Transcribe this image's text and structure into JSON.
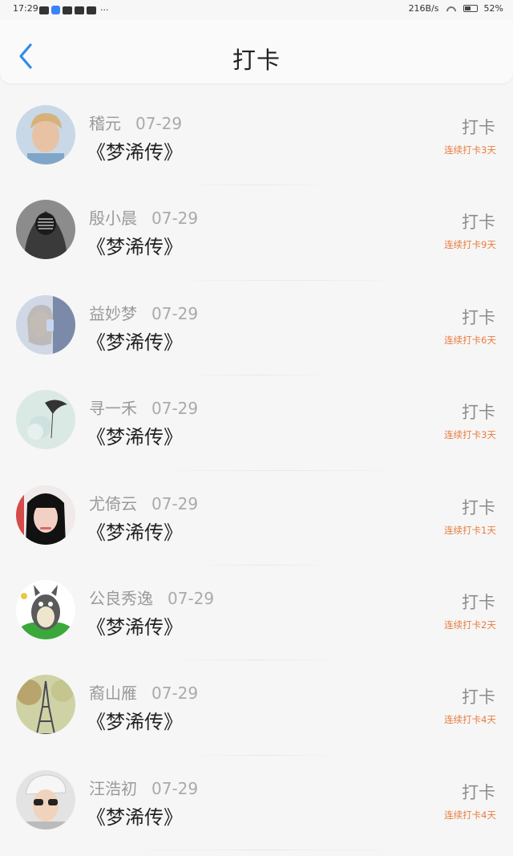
{
  "status_bar": {
    "time": "17:29",
    "more": "···",
    "net_speed": "216B/s",
    "battery": "52%",
    "battery_level": 0.52
  },
  "header": {
    "title": "打卡",
    "back_icon": "chevron-left-icon",
    "accent": "#2f8bea"
  },
  "list": [
    {
      "name": "稽元",
      "date": "07-29",
      "book": "《梦浠传》",
      "checkin": "打卡",
      "streak": "连续打卡3天"
    },
    {
      "name": "殷小晨",
      "date": "07-29",
      "book": "《梦浠传》",
      "checkin": "打卡",
      "streak": "连续打卡9天"
    },
    {
      "name": "益妙梦",
      "date": "07-29",
      "book": "《梦浠传》",
      "checkin": "打卡",
      "streak": "连续打卡6天"
    },
    {
      "name": "寻一禾",
      "date": "07-29",
      "book": "《梦浠传》",
      "checkin": "打卡",
      "streak": "连续打卡3天"
    },
    {
      "name": "尤倚云",
      "date": "07-29",
      "book": "《梦浠传》",
      "checkin": "打卡",
      "streak": "连续打卡1天"
    },
    {
      "name": "公良秀逸",
      "date": "07-29",
      "book": "《梦浠传》",
      "checkin": "打卡",
      "streak": "连续打卡2天"
    },
    {
      "name": "裔山雁",
      "date": "07-29",
      "book": "《梦浠传》",
      "checkin": "打卡",
      "streak": "连续打卡4天"
    },
    {
      "name": "汪浩初",
      "date": "07-29",
      "book": "《梦浠传》",
      "checkin": "打卡",
      "streak": "连续打卡4天"
    }
  ],
  "colors": {
    "streak": "#e87c3e",
    "name": "#9a9a9a",
    "background": "#f6f6f6"
  }
}
